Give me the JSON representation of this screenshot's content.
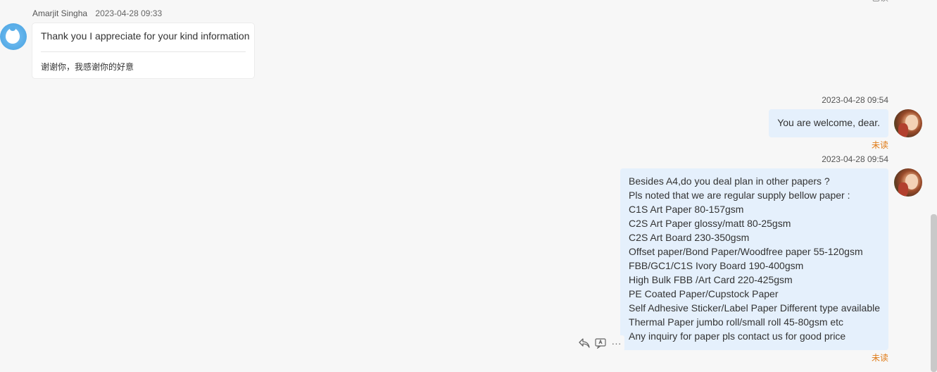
{
  "top_clipped_glyph": "已读",
  "incoming": {
    "sender": "Amarjit Singha",
    "time": "2023-04-28 09:33",
    "text": "Thank you I appreciate for your kind information",
    "translation": "谢谢你，我感谢你的好意"
  },
  "outgoing": [
    {
      "time": "2023-04-28 09:54",
      "lines": [
        "You are welcome, dear."
      ],
      "status": "未读"
    },
    {
      "time": "2023-04-28 09:54",
      "lines": [
        "Besides A4,do you deal plan in other papers ?",
        "Pls noted that we are regular supply bellow paper :",
        "C1S Art Paper 80-157gsm",
        "C2S Art Paper glossy/matt 80-25gsm",
        "C2S Art Board 230-350gsm",
        "Offset paper/Bond Paper/Woodfree paper 55-120gsm",
        "FBB/GC1/C1S Ivory Board 190-400gsm",
        "High Bulk FBB /Art Card 220-425gsm",
        "PE Coated Paper/Cupstock Paper",
        "Self Adhesive Sticker/Label Paper Different type available",
        "Thermal Paper jumbo roll/small roll 45-80gsm etc",
        "Any inquiry for paper pls contact us for good price"
      ],
      "status": "未读"
    }
  ],
  "message_actions": {
    "reply_icon": "reply-icon",
    "translate_icon": "translate-icon",
    "more_icon": "more-icon",
    "more_glyph": "···"
  },
  "colors": {
    "background": "#f7f7f7",
    "incoming_bubble": "#ffffff",
    "outgoing_bubble": "#e5f0fc",
    "unread_status": "#e07b17"
  }
}
